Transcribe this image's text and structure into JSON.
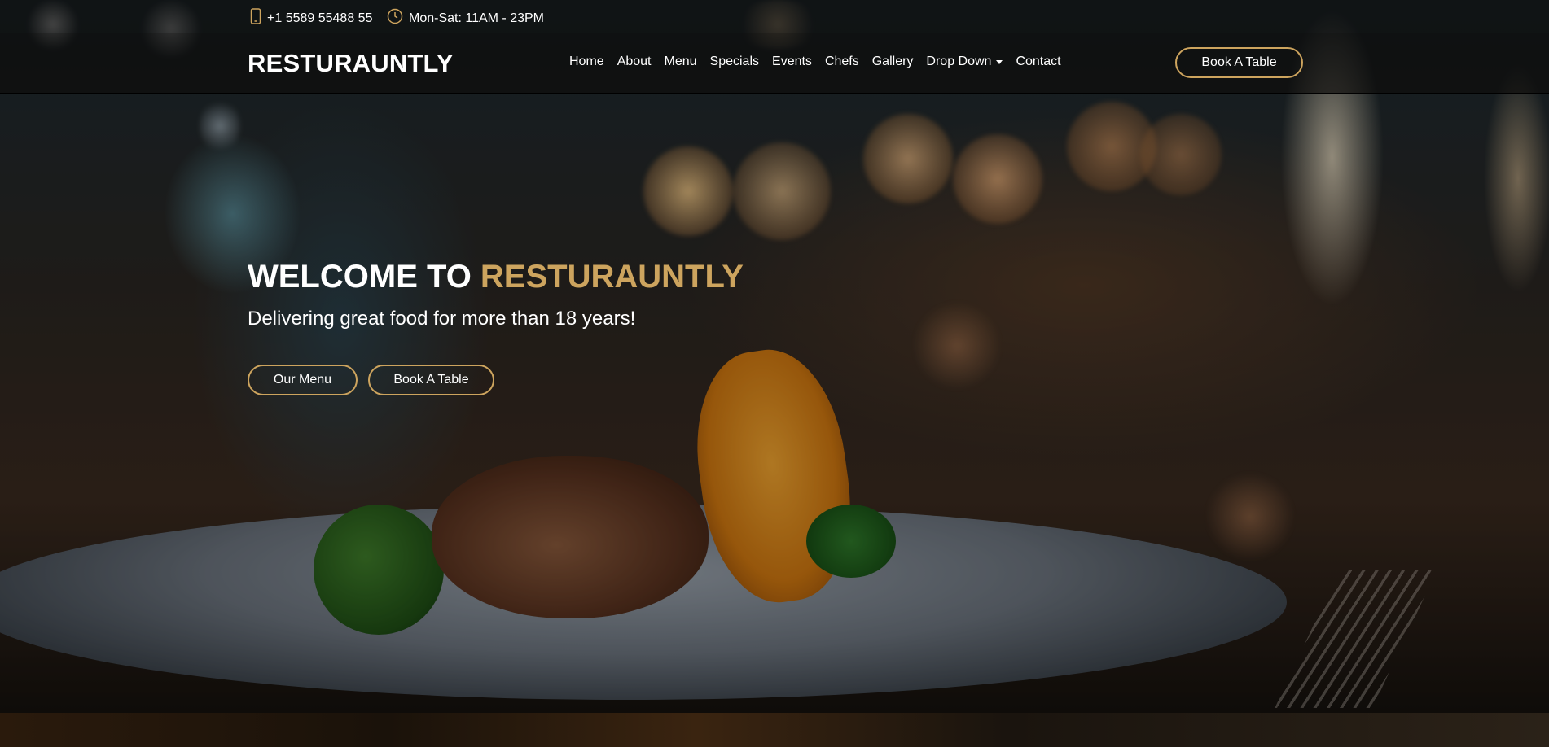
{
  "topbar": {
    "phone": "+1 5589 55488 55",
    "hours": "Mon-Sat: 11AM - 23PM",
    "phone_icon": "mobile-phone-icon",
    "clock_icon": "clock-icon"
  },
  "navbar": {
    "logo": "RESTURAUNTLY",
    "links": [
      "Home",
      "About",
      "Menu",
      "Specials",
      "Events",
      "Chefs",
      "Gallery",
      "Drop Down",
      "Contact"
    ],
    "book_button": "Book A Table"
  },
  "hero": {
    "title_prefix": "WELCOME TO ",
    "title_brand": "RESTURAUNTLY",
    "subtitle": "Delivering great food for more than 18 years!",
    "menu_button": "Our Menu",
    "book_button": "Book A Table"
  },
  "colors": {
    "accent": "#cda45e",
    "dark": "#0c0b09"
  }
}
